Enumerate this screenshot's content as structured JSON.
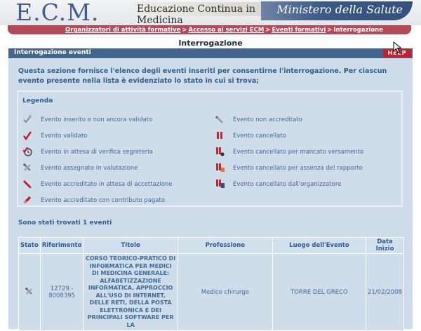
{
  "header": {
    "logo": "E.C.M.",
    "tagline": "Educazione Continua in Medicina",
    "ministry": "Ministero della Salute"
  },
  "breadcrumb": {
    "items": [
      "Organizzatori di attività formative",
      "Accesso ai servizi ECM",
      "Eventi formativi"
    ],
    "current": "Interrogazione",
    "separator": ">"
  },
  "page_title": "Interrogazione",
  "section": {
    "title": "Interrogazione eventi",
    "help_label": "HELP"
  },
  "intro": "Questa sezione fornisce l'elenco degli eventi inseriti per consentirne l'interrogazione. Per ciascun evento presente nella lista è evidenziato lo stato in cui si trova;",
  "legend": {
    "title": "Legenda",
    "left": [
      {
        "icon": "pencil-check-icon",
        "label": "Evento inserito e non ancora validato"
      },
      {
        "icon": "red-check-icon",
        "label": "Evento validato"
      },
      {
        "icon": "clock-check-icon",
        "label": "Evento in attesa di verifica segreteria"
      },
      {
        "icon": "crossed-tools-icon",
        "label": "Evento assegnato in valutazione"
      },
      {
        "icon": "red-pen-icon",
        "label": "Evento accreditato in attesa di accettazione"
      },
      {
        "icon": "pen-coin-icon",
        "label": "Evento accreditato con contributo pagato"
      }
    ],
    "right": [
      {
        "icon": "grey-pen-icon",
        "label": "Evento non accreditato"
      },
      {
        "icon": "red-pause-icon",
        "label": "Evento cancellato"
      },
      {
        "icon": "pause-coin-icon",
        "label": "Evento cancellato per mancato versamento"
      },
      {
        "icon": "pause-report-icon",
        "label": "Evento cancellato per assenza del rapporto"
      },
      {
        "icon": "pause-doc-icon",
        "label": "Evento cancellato dall'organizzatore"
      }
    ]
  },
  "results": {
    "found_text": "Sono stati trovati 1 eventi",
    "columns": [
      "Stato",
      "Riferimento",
      "Titolo",
      "Professione",
      "Luogo dell'Evento",
      "Data Inizio"
    ],
    "rows": [
      {
        "status_icon": "crossed-tools-icon",
        "riferimento": "12729 - 8008395",
        "titolo": "CORSO TEORICO-PRATICO DI INFORMATICA PER MEDICI DI MEDICINA GENERALE: ALFABETIZZAZIONE INFORMATICA, APPROCCIO ALL'USO DI INTERNET, DELLE RETI, DELLA POSTA ELETTRONICA E DEI PRINCIPALI SOFTWARE PER LA",
        "professione": "Medico chirurgo",
        "luogo": "TORRE DEL GRECO",
        "data_inizio": "21/02/2008"
      }
    ]
  },
  "colors": {
    "header_blue": "#3e5f8e",
    "accent_red": "#b44958",
    "section_blue": "#43658f",
    "content_bg": "#cfdcea",
    "text_blue": "#3f6c98",
    "help_red": "#c2202e"
  }
}
